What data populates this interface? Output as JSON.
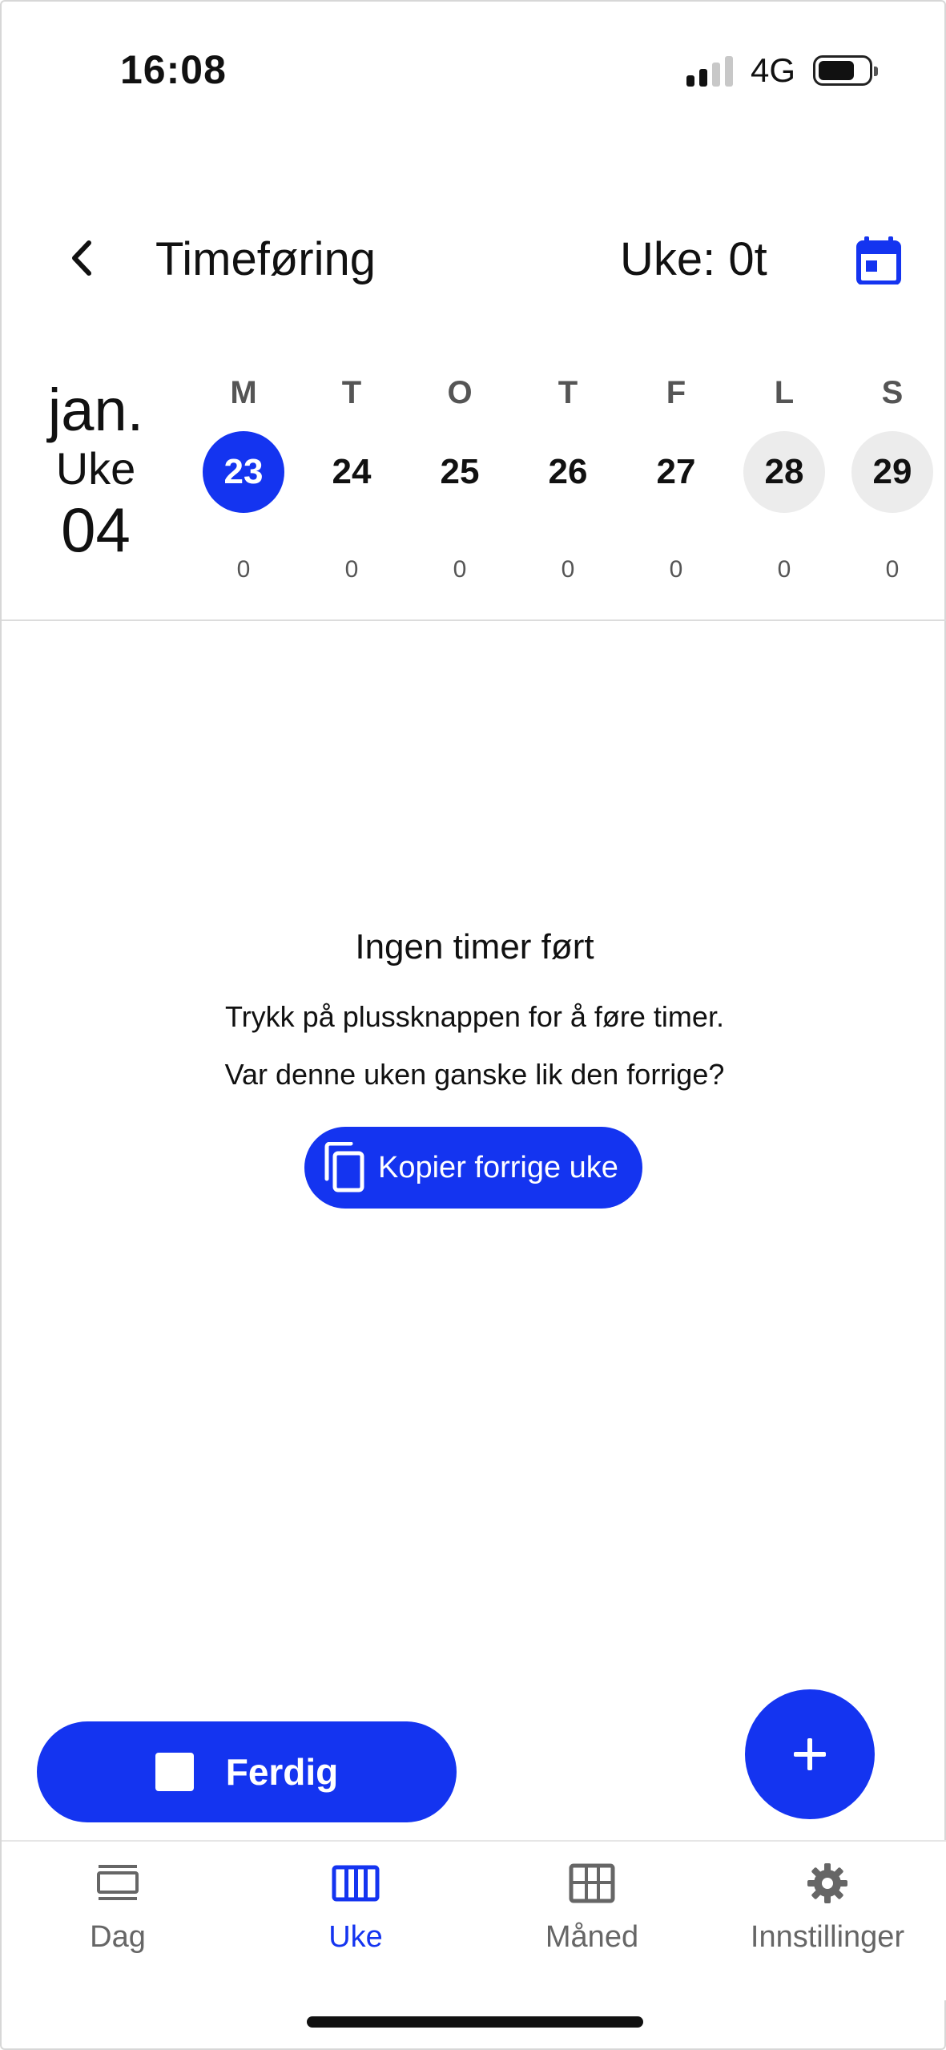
{
  "status_bar": {
    "time": "16:08",
    "network": "4G"
  },
  "header": {
    "title": "Timeføring",
    "week_hours": "Uke: 0t"
  },
  "week": {
    "month": "jan.",
    "week_label": "Uke",
    "week_number": "04",
    "days": [
      {
        "letter": "M",
        "date": "23",
        "hours": "0",
        "state": "selected"
      },
      {
        "letter": "T",
        "date": "24",
        "hours": "0",
        "state": "normal"
      },
      {
        "letter": "O",
        "date": "25",
        "hours": "0",
        "state": "normal"
      },
      {
        "letter": "T",
        "date": "26",
        "hours": "0",
        "state": "normal"
      },
      {
        "letter": "F",
        "date": "27",
        "hours": "0",
        "state": "normal"
      },
      {
        "letter": "L",
        "date": "28",
        "hours": "0",
        "state": "weekend"
      },
      {
        "letter": "S",
        "date": "29",
        "hours": "0",
        "state": "weekend"
      }
    ]
  },
  "empty_state": {
    "title": "Ingen timer ført",
    "line1": "Trykk på plussknappen for å føre timer.",
    "line2": "Var denne uken ganske lik den forrige?",
    "copy_button": "Kopier forrige uke"
  },
  "actions": {
    "done_label": "Ferdig",
    "add_label": "+"
  },
  "nav": [
    {
      "label": "Dag",
      "icon": "day-view-icon",
      "active": false
    },
    {
      "label": "Uke",
      "icon": "week-view-icon",
      "active": true
    },
    {
      "label": "Måned",
      "icon": "month-grid-icon",
      "active": false
    },
    {
      "label": "Innstillinger",
      "icon": "gear-icon",
      "active": false
    }
  ],
  "colors": {
    "accent": "#1434f0",
    "weekend_bg": "#ececec",
    "muted_text": "#666666"
  }
}
